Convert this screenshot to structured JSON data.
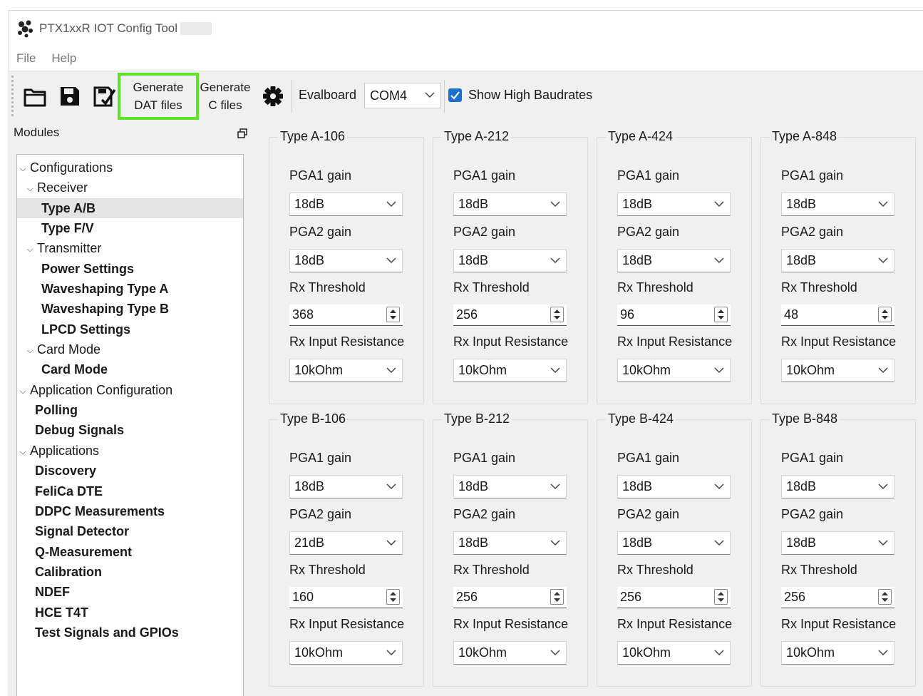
{
  "title": "PTX1xxR IOT Config Tool",
  "menu": [
    "File",
    "Help"
  ],
  "toolbar": {
    "generate_dat": [
      "Generate",
      "DAT files"
    ],
    "generate_c": [
      "Generate",
      "C files"
    ],
    "evalboard_label": "Evalboard",
    "port": "COM4",
    "show_high_baudrates": "Show High Baudrates",
    "show_high_baudrates_checked": true,
    "highlight_color": "#5ce42a",
    "accent_color": "#1a6fd1"
  },
  "modules": {
    "header": "Modules",
    "tree": [
      {
        "label": "Configurations",
        "level": "lvl0",
        "arrow": true,
        "bold": false
      },
      {
        "label": "Receiver",
        "level": "lvl1",
        "arrow": true,
        "bold": false
      },
      {
        "label": "Type A/B",
        "level": "lvl2",
        "arrow": false,
        "bold": true,
        "selected": true
      },
      {
        "label": "Type F/V",
        "level": "lvl2",
        "arrow": false,
        "bold": true
      },
      {
        "label": "Transmitter",
        "level": "lvl1",
        "arrow": true,
        "bold": false
      },
      {
        "label": "Power Settings",
        "level": "lvl2",
        "arrow": false,
        "bold": true
      },
      {
        "label": "Waveshaping Type A",
        "level": "lvl2",
        "arrow": false,
        "bold": true
      },
      {
        "label": "Waveshaping Type B",
        "level": "lvl2",
        "arrow": false,
        "bold": true
      },
      {
        "label": "LPCD Settings",
        "level": "lvl2",
        "arrow": false,
        "bold": true
      },
      {
        "label": "Card Mode",
        "level": "lvl1",
        "arrow": true,
        "bold": false
      },
      {
        "label": "Card Mode",
        "level": "lvl2",
        "arrow": false,
        "bold": true
      },
      {
        "label": "Application Configuration",
        "level": "lvl0",
        "arrow": true,
        "bold": false
      },
      {
        "label": "Polling",
        "level": "lvl1b",
        "arrow": false,
        "bold": true
      },
      {
        "label": "Debug Signals",
        "level": "lvl1b",
        "arrow": false,
        "bold": true
      },
      {
        "label": "Applications",
        "level": "lvl0",
        "arrow": true,
        "bold": false
      },
      {
        "label": "Discovery",
        "level": "lvl1b",
        "arrow": false,
        "bold": true
      },
      {
        "label": "FeliCa DTE",
        "level": "lvl1b",
        "arrow": false,
        "bold": true
      },
      {
        "label": "DDPC Measurements",
        "level": "lvl1b",
        "arrow": false,
        "bold": true
      },
      {
        "label": "Signal Detector",
        "level": "lvl1b",
        "arrow": false,
        "bold": true
      },
      {
        "label": "Q-Measurement",
        "level": "lvl1b",
        "arrow": false,
        "bold": true
      },
      {
        "label": "Calibration",
        "level": "lvl1b",
        "arrow": false,
        "bold": true
      },
      {
        "label": "NDEF",
        "level": "lvl1b",
        "arrow": false,
        "bold": true
      },
      {
        "label": "HCE T4T",
        "level": "lvl1b",
        "arrow": false,
        "bold": true
      },
      {
        "label": "Test Signals and GPIOs",
        "level": "lvl1b",
        "arrow": false,
        "bold": true
      }
    ]
  },
  "labels": {
    "pga1": "PGA1 gain",
    "pga2": "PGA2 gain",
    "rx_threshold": "Rx Threshold",
    "rx_input_resistance": "Rx Input Resistance"
  },
  "groups": [
    {
      "title": "Type A-106",
      "pga1": "18dB",
      "pga2": "18dB",
      "rx_threshold": "368",
      "rx_input_resistance": "10kOhm"
    },
    {
      "title": "Type A-212",
      "pga1": "18dB",
      "pga2": "18dB",
      "rx_threshold": "256",
      "rx_input_resistance": "10kOhm"
    },
    {
      "title": "Type A-424",
      "pga1": "18dB",
      "pga2": "18dB",
      "rx_threshold": "96",
      "rx_input_resistance": "10kOhm"
    },
    {
      "title": "Type A-848",
      "pga1": "18dB",
      "pga2": "18dB",
      "rx_threshold": "48",
      "rx_input_resistance": "10kOhm"
    },
    {
      "title": "Type B-106",
      "pga1": "18dB",
      "pga2": "21dB",
      "rx_threshold": "160",
      "rx_input_resistance": "10kOhm"
    },
    {
      "title": "Type B-212",
      "pga1": "18dB",
      "pga2": "18dB",
      "rx_threshold": "256",
      "rx_input_resistance": "10kOhm"
    },
    {
      "title": "Type B-424",
      "pga1": "18dB",
      "pga2": "18dB",
      "rx_threshold": "256",
      "rx_input_resistance": "10kOhm"
    },
    {
      "title": "Type B-848",
      "pga1": "18dB",
      "pga2": "18dB",
      "rx_threshold": "256",
      "rx_input_resistance": "10kOhm"
    }
  ]
}
